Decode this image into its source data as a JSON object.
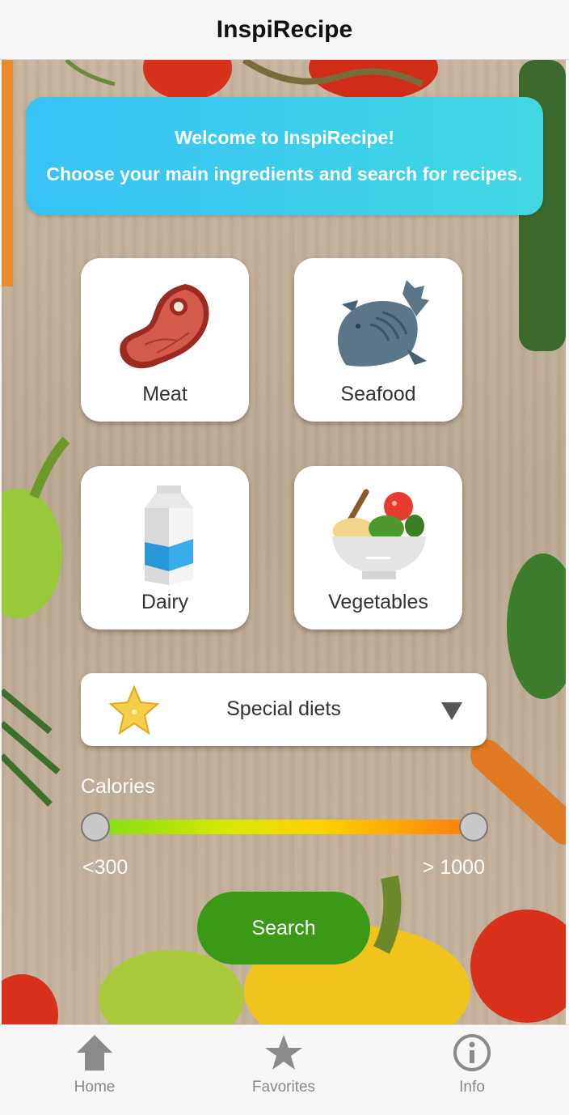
{
  "app": {
    "title": "InspiRecipe"
  },
  "banner": {
    "line1": "Welcome to InspiRecipe!",
    "line2": "Choose your main ingredients and search for recipes."
  },
  "categories": [
    {
      "label": "Meat",
      "icon": "meat-icon"
    },
    {
      "label": "Seafood",
      "icon": "fish-icon"
    },
    {
      "label": "Dairy",
      "icon": "milk-carton-icon"
    },
    {
      "label": "Vegetables",
      "icon": "salad-bowl-icon"
    }
  ],
  "diet": {
    "label": "Special diets",
    "icon": "star-fruit-icon"
  },
  "calories": {
    "label": "Calories",
    "min_label": "<300",
    "max_label": "> 1000",
    "range_start_fraction": 0.0,
    "range_end_fraction": 1.0
  },
  "search": {
    "label": "Search"
  },
  "tabs": [
    {
      "label": "Home",
      "icon": "home-icon"
    },
    {
      "label": "Favorites",
      "icon": "star-icon"
    },
    {
      "label": "Info",
      "icon": "info-icon"
    }
  ],
  "colors": {
    "banner_start": "#38c2f6",
    "banner_end": "#41d8e4",
    "search_button": "#3a9a18",
    "slider_start": "#7fdc1b",
    "slider_end": "#ff7a10"
  }
}
